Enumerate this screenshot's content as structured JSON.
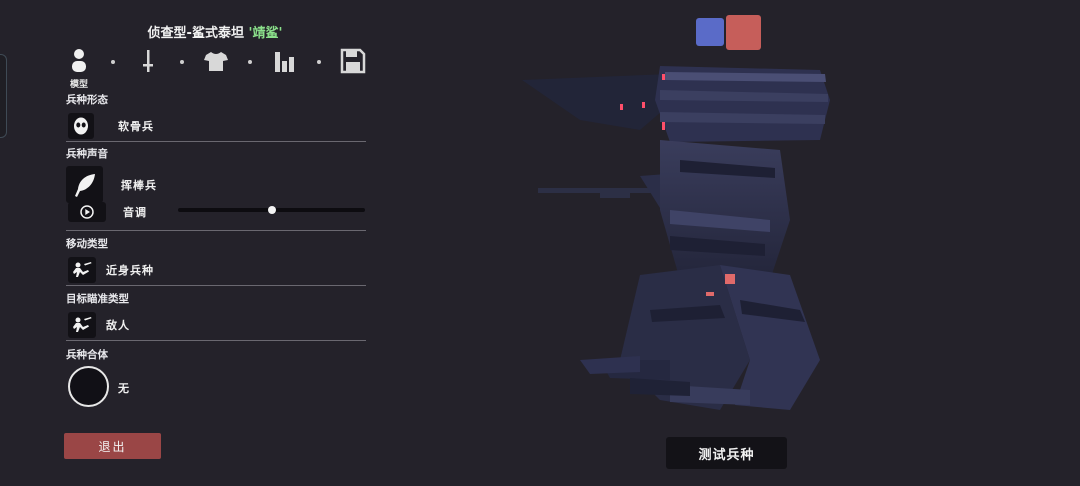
{
  "header": {
    "title_prefix": "侦查型-鲨式泰坦 ",
    "title_quote": "'靖鲨'"
  },
  "toolbar": {
    "items": [
      {
        "icon": "person-icon",
        "label": "模型"
      },
      {
        "icon": "sword-icon",
        "label": ""
      },
      {
        "icon": "shirt-icon",
        "label": ""
      },
      {
        "icon": "bar-chart-icon",
        "label": ""
      },
      {
        "icon": "save-icon",
        "label": ""
      }
    ]
  },
  "form": {
    "label": "兵种形态",
    "value": "软骨兵",
    "icon": "mask-icon"
  },
  "voice": {
    "label": "兵种声音",
    "value": "挥棒兵",
    "icon": "feather-icon",
    "pitch_label": "音调",
    "pitch_value": 0.5,
    "play_icon": "play-icon"
  },
  "movement": {
    "label": "移动类型",
    "value": "近身兵种",
    "icon": "melee-icon"
  },
  "targeting": {
    "label": "目标瞄准类型",
    "value": "敌人",
    "icon": "target-enemy-icon"
  },
  "combine": {
    "label": "兵种合体",
    "value": "无"
  },
  "buttons": {
    "exit": "退出",
    "test": "测试兵种"
  },
  "teams": {
    "blue_color": "#5a6bc8",
    "red_color": "#c65e5a",
    "selected": "red"
  },
  "colors": {
    "background": "#24222a",
    "exit_button": "#9a4646",
    "title_accent": "#8be08b"
  }
}
